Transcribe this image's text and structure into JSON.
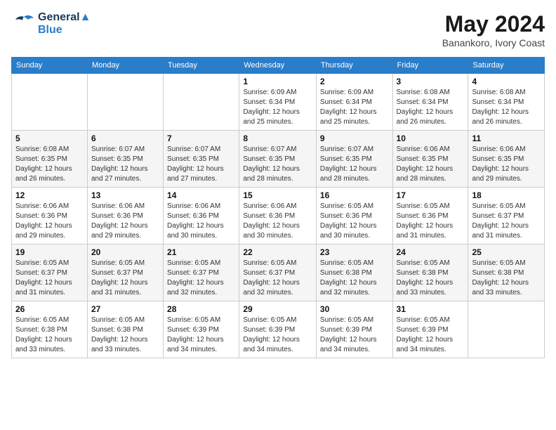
{
  "logo": {
    "line1": "General",
    "line2": "Blue"
  },
  "title": {
    "month_year": "May 2024",
    "location": "Banankoro, Ivory Coast"
  },
  "weekdays": [
    "Sunday",
    "Monday",
    "Tuesday",
    "Wednesday",
    "Thursday",
    "Friday",
    "Saturday"
  ],
  "weeks": [
    [
      {
        "day": "",
        "info": ""
      },
      {
        "day": "",
        "info": ""
      },
      {
        "day": "",
        "info": ""
      },
      {
        "day": "1",
        "info": "Sunrise: 6:09 AM\nSunset: 6:34 PM\nDaylight: 12 hours\nand 25 minutes."
      },
      {
        "day": "2",
        "info": "Sunrise: 6:09 AM\nSunset: 6:34 PM\nDaylight: 12 hours\nand 25 minutes."
      },
      {
        "day": "3",
        "info": "Sunrise: 6:08 AM\nSunset: 6:34 PM\nDaylight: 12 hours\nand 26 minutes."
      },
      {
        "day": "4",
        "info": "Sunrise: 6:08 AM\nSunset: 6:34 PM\nDaylight: 12 hours\nand 26 minutes."
      }
    ],
    [
      {
        "day": "5",
        "info": "Sunrise: 6:08 AM\nSunset: 6:35 PM\nDaylight: 12 hours\nand 26 minutes."
      },
      {
        "day": "6",
        "info": "Sunrise: 6:07 AM\nSunset: 6:35 PM\nDaylight: 12 hours\nand 27 minutes."
      },
      {
        "day": "7",
        "info": "Sunrise: 6:07 AM\nSunset: 6:35 PM\nDaylight: 12 hours\nand 27 minutes."
      },
      {
        "day": "8",
        "info": "Sunrise: 6:07 AM\nSunset: 6:35 PM\nDaylight: 12 hours\nand 28 minutes."
      },
      {
        "day": "9",
        "info": "Sunrise: 6:07 AM\nSunset: 6:35 PM\nDaylight: 12 hours\nand 28 minutes."
      },
      {
        "day": "10",
        "info": "Sunrise: 6:06 AM\nSunset: 6:35 PM\nDaylight: 12 hours\nand 28 minutes."
      },
      {
        "day": "11",
        "info": "Sunrise: 6:06 AM\nSunset: 6:35 PM\nDaylight: 12 hours\nand 29 minutes."
      }
    ],
    [
      {
        "day": "12",
        "info": "Sunrise: 6:06 AM\nSunset: 6:36 PM\nDaylight: 12 hours\nand 29 minutes."
      },
      {
        "day": "13",
        "info": "Sunrise: 6:06 AM\nSunset: 6:36 PM\nDaylight: 12 hours\nand 29 minutes."
      },
      {
        "day": "14",
        "info": "Sunrise: 6:06 AM\nSunset: 6:36 PM\nDaylight: 12 hours\nand 30 minutes."
      },
      {
        "day": "15",
        "info": "Sunrise: 6:06 AM\nSunset: 6:36 PM\nDaylight: 12 hours\nand 30 minutes."
      },
      {
        "day": "16",
        "info": "Sunrise: 6:05 AM\nSunset: 6:36 PM\nDaylight: 12 hours\nand 30 minutes."
      },
      {
        "day": "17",
        "info": "Sunrise: 6:05 AM\nSunset: 6:36 PM\nDaylight: 12 hours\nand 31 minutes."
      },
      {
        "day": "18",
        "info": "Sunrise: 6:05 AM\nSunset: 6:37 PM\nDaylight: 12 hours\nand 31 minutes."
      }
    ],
    [
      {
        "day": "19",
        "info": "Sunrise: 6:05 AM\nSunset: 6:37 PM\nDaylight: 12 hours\nand 31 minutes."
      },
      {
        "day": "20",
        "info": "Sunrise: 6:05 AM\nSunset: 6:37 PM\nDaylight: 12 hours\nand 31 minutes."
      },
      {
        "day": "21",
        "info": "Sunrise: 6:05 AM\nSunset: 6:37 PM\nDaylight: 12 hours\nand 32 minutes."
      },
      {
        "day": "22",
        "info": "Sunrise: 6:05 AM\nSunset: 6:37 PM\nDaylight: 12 hours\nand 32 minutes."
      },
      {
        "day": "23",
        "info": "Sunrise: 6:05 AM\nSunset: 6:38 PM\nDaylight: 12 hours\nand 32 minutes."
      },
      {
        "day": "24",
        "info": "Sunrise: 6:05 AM\nSunset: 6:38 PM\nDaylight: 12 hours\nand 33 minutes."
      },
      {
        "day": "25",
        "info": "Sunrise: 6:05 AM\nSunset: 6:38 PM\nDaylight: 12 hours\nand 33 minutes."
      }
    ],
    [
      {
        "day": "26",
        "info": "Sunrise: 6:05 AM\nSunset: 6:38 PM\nDaylight: 12 hours\nand 33 minutes."
      },
      {
        "day": "27",
        "info": "Sunrise: 6:05 AM\nSunset: 6:38 PM\nDaylight: 12 hours\nand 33 minutes."
      },
      {
        "day": "28",
        "info": "Sunrise: 6:05 AM\nSunset: 6:39 PM\nDaylight: 12 hours\nand 34 minutes."
      },
      {
        "day": "29",
        "info": "Sunrise: 6:05 AM\nSunset: 6:39 PM\nDaylight: 12 hours\nand 34 minutes."
      },
      {
        "day": "30",
        "info": "Sunrise: 6:05 AM\nSunset: 6:39 PM\nDaylight: 12 hours\nand 34 minutes."
      },
      {
        "day": "31",
        "info": "Sunrise: 6:05 AM\nSunset: 6:39 PM\nDaylight: 12 hours\nand 34 minutes."
      },
      {
        "day": "",
        "info": ""
      }
    ]
  ]
}
